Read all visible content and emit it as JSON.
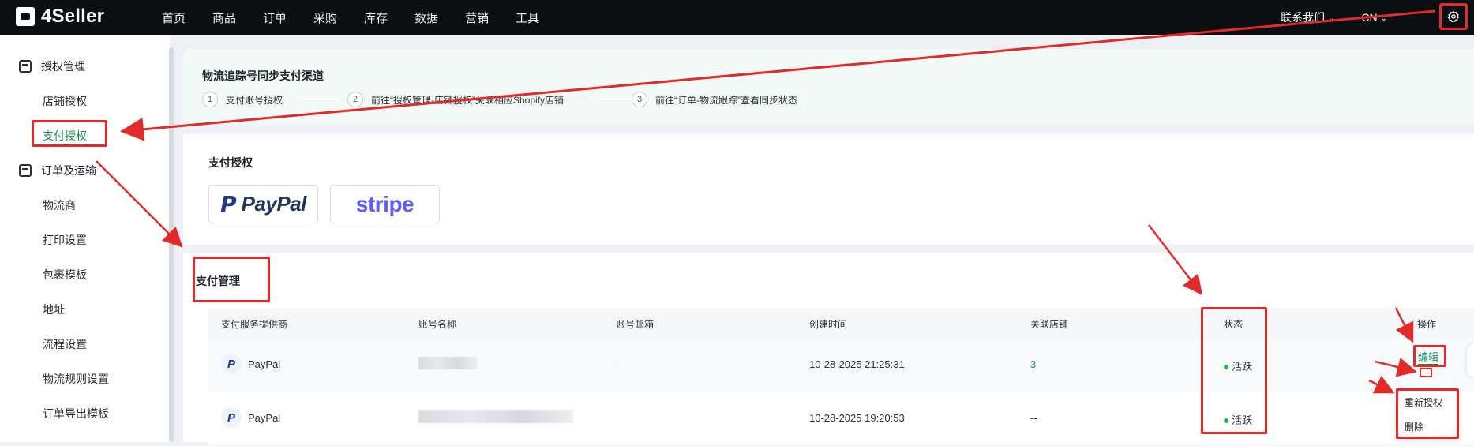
{
  "app": {
    "brand": "4Seller"
  },
  "nav": {
    "items": [
      "首页",
      "商品",
      "订单",
      "采购",
      "库存",
      "数据",
      "营销",
      "工具"
    ]
  },
  "header": {
    "contact": "联系我们",
    "lang": "CN"
  },
  "sidebar": {
    "sections": [
      {
        "title": "授权管理",
        "items": [
          "店铺授权",
          "支付授权"
        ]
      },
      {
        "title": "订单及运输",
        "items": [
          "物流商",
          "打印设置",
          "包裹模板",
          "地址",
          "流程设置",
          "物流规则设置",
          "订单导出模板"
        ]
      }
    ],
    "active": "支付授权"
  },
  "guide": {
    "title": "物流追踪号同步支付渠道",
    "steps": [
      {
        "num": "1",
        "text": "支付账号授权"
      },
      {
        "num": "2",
        "text": "前往“授权管理-店铺授权”关联相应Shopify店铺"
      },
      {
        "num": "3",
        "text": "前往“订单-物流跟踪”查看同步状态"
      }
    ]
  },
  "auth": {
    "title": "支付授权",
    "providers": [
      {
        "name": "PayPal"
      },
      {
        "name": "stripe"
      }
    ],
    "paypal_mark": "P"
  },
  "manage": {
    "title": "支付管理",
    "columns": [
      "支付服务提供商",
      "账号名称",
      "账号邮箱",
      "创建时间",
      "关联店铺",
      "状态",
      "操作"
    ],
    "rows": [
      {
        "provider": "PayPal",
        "email": "-",
        "created": "10-28-2025 21:25:31",
        "stores": "3",
        "status": "活跃",
        "action": "编辑",
        "more": "···"
      },
      {
        "provider": "PayPal",
        "email": "",
        "created": "10-28-2025 19:20:53",
        "stores": "--",
        "status": "活跃"
      }
    ],
    "row_menu": [
      "重新授权",
      "删除"
    ]
  },
  "colors": {
    "accent": "#1b8a5a",
    "annotation": "#e32a2a",
    "status": "#1db954",
    "topbar": "#0b0f12"
  },
  "icons": [
    "gear-icon",
    "chevron-down-icon",
    "auth-section-icon",
    "order-section-icon",
    "paypal-icon"
  ]
}
